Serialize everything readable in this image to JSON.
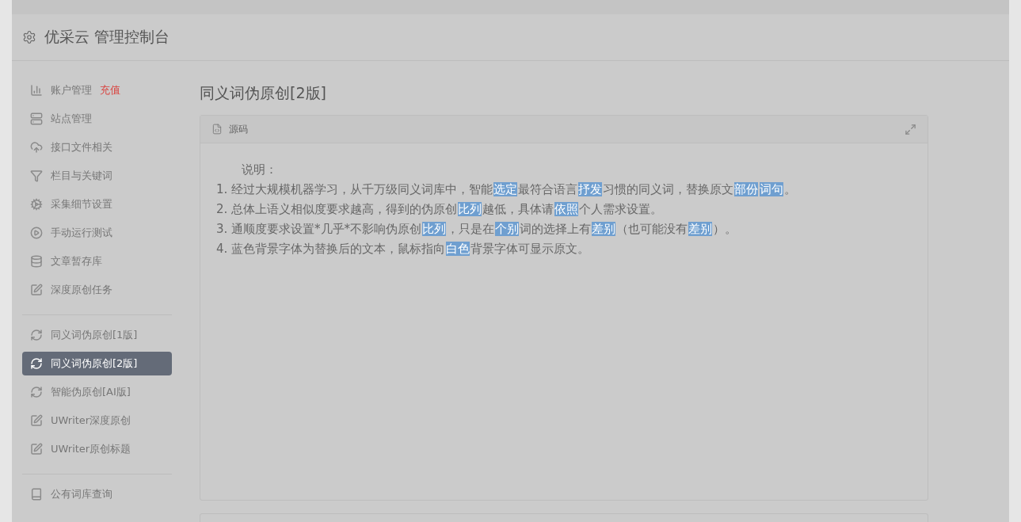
{
  "header": {
    "title": "优采云 管理控制台"
  },
  "sidebar": {
    "groups": [
      [
        {
          "label": "账户管理",
          "badge": "充值",
          "selected": false
        },
        {
          "label": "站点管理",
          "selected": false
        },
        {
          "label": "接口文件相关",
          "selected": false
        },
        {
          "label": "栏目与关键词",
          "selected": false
        },
        {
          "label": "采集细节设置",
          "selected": false
        },
        {
          "label": "手动运行测试",
          "selected": false
        },
        {
          "label": "文章暂存库",
          "selected": false
        },
        {
          "label": "深度原创任务",
          "selected": false
        }
      ],
      [
        {
          "label": "同义词伪原创[1版]",
          "selected": false
        },
        {
          "label": "同义词伪原创[2版]",
          "selected": true
        },
        {
          "label": "智能伪原创[AI版]",
          "selected": false
        },
        {
          "label": "UWriter深度原创",
          "selected": false
        },
        {
          "label": "UWriter原创标题",
          "selected": false
        }
      ],
      [
        {
          "label": "公有词库查询",
          "selected": false
        }
      ]
    ]
  },
  "page_title": "同义词伪原创[2版]",
  "panel": {
    "title": "源码",
    "intro": "说明：",
    "lines": [
      [
        {
          "text": "1. 经过大规模机器学习，从千万级同义词库中，智能",
          "highlighted": false
        },
        {
          "text": "选定",
          "highlighted": true
        },
        {
          "text": "最符合语言",
          "highlighted": false
        },
        {
          "text": "抒发",
          "highlighted": true
        },
        {
          "text": "习惯的同义词，替换原文",
          "highlighted": false
        },
        {
          "text": "部份",
          "highlighted": true
        },
        {
          "text": "词句",
          "highlighted": true
        },
        {
          "text": "。",
          "highlighted": false
        }
      ],
      [
        {
          "text": "2. 总体上语义相似度要求越高，得到的伪原创",
          "highlighted": false
        },
        {
          "text": "比列",
          "highlighted": true
        },
        {
          "text": "越低，具体请",
          "highlighted": false
        },
        {
          "text": "依照",
          "highlighted": true
        },
        {
          "text": "个人需求设置。",
          "highlighted": false
        }
      ],
      [
        {
          "text": "3. 通顺度要求设置*几乎*不影响伪原创",
          "highlighted": false
        },
        {
          "text": "比列",
          "highlighted": true
        },
        {
          "text": "，只是在",
          "highlighted": false
        },
        {
          "text": "个别",
          "highlighted": true
        },
        {
          "text": "词的选择上有",
          "highlighted": false
        },
        {
          "text": "差别",
          "highlighted": true
        },
        {
          "text": "（也可能没有",
          "highlighted": false
        },
        {
          "text": "差别",
          "highlighted": true
        },
        {
          "text": "）。",
          "highlighted": false
        }
      ],
      [
        {
          "text": "4. 蓝色背景字体为替换后的文本，鼠标指向",
          "highlighted": false
        },
        {
          "text": "白色",
          "highlighted": true
        },
        {
          "text": "背景字体可显示原文。",
          "highlighted": false
        }
      ]
    ]
  }
}
